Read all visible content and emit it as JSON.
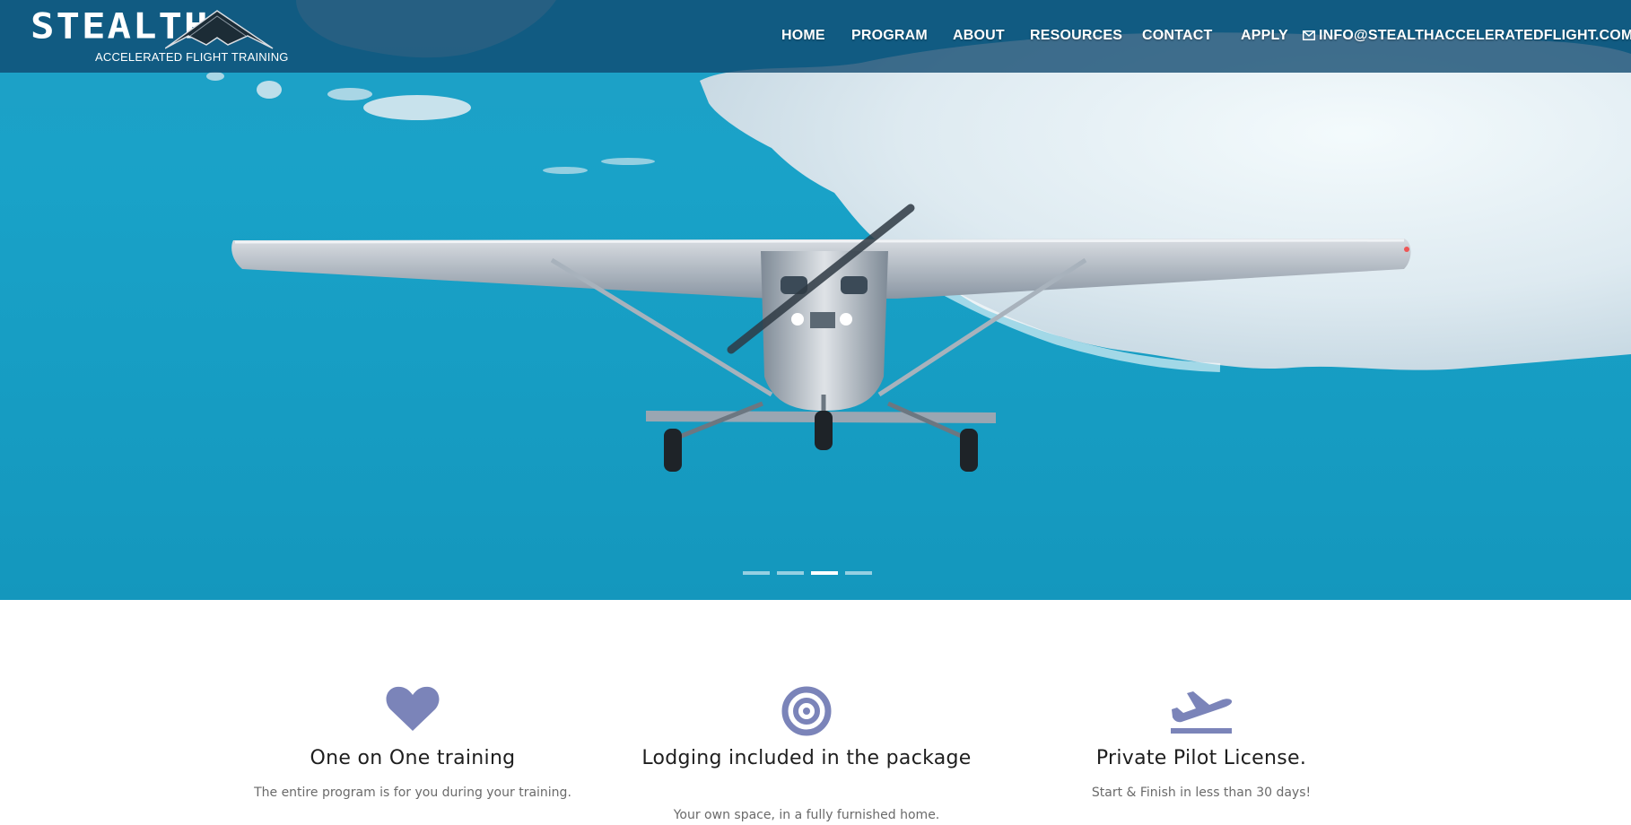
{
  "logo": {
    "word": "STEALTH",
    "tagline": "ACCELERATED FLIGHT TRAINING"
  },
  "nav": {
    "items": [
      "HOME",
      "PROGRAM",
      "ABOUT",
      "RESOURCES",
      "CONTACT",
      "APPLY"
    ],
    "email": "INFO@STEALTHACCELERATEDFLIGHT.COM",
    "email_icon": "mail-icon"
  },
  "carousel": {
    "slide_count": 4,
    "active_slide": 3
  },
  "features": [
    {
      "icon": "heart-icon",
      "title": "One on One training",
      "text": "The entire program is for you during your training."
    },
    {
      "icon": "target-icon",
      "title": "Lodging included in the package",
      "text": "Your own space, in a fully furnished home."
    },
    {
      "icon": "plane-takeoff-icon",
      "title": "Private Pilot License.",
      "text": "Start & Finish in less than 30 days!"
    }
  ],
  "colors": {
    "accent_icon": "#7b84b9",
    "nav_bg": "#0e486e",
    "sky": "#1a9fc6"
  }
}
